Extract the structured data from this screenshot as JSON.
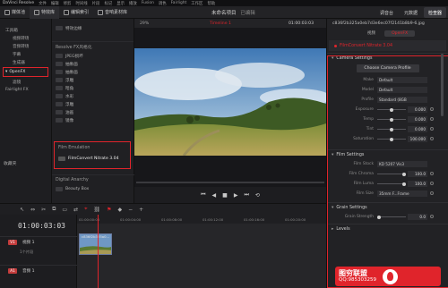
{
  "menu": {
    "app": "DaVinci Resolve",
    "items": [
      "文件",
      "编辑",
      "修剪",
      "时间线",
      "片段",
      "标记",
      "显示",
      "播放",
      "Fusion",
      "调色",
      "Fairlight",
      "工作区",
      "帮助"
    ]
  },
  "toolbar": {
    "media_pool": "媒体池",
    "effects_library": "特效库",
    "edit_index": "编辑索引",
    "sound_library": "音响素材库",
    "project_title": "未命名项目",
    "edited": "已编辑",
    "mixer": "调音台",
    "metadata": "元数据",
    "inspector": "检查器"
  },
  "bins": {
    "items": [
      {
        "label": "工具箱",
        "sub": false
      },
      {
        "label": "视频转场",
        "sub": true
      },
      {
        "label": "音频转场",
        "sub": true
      },
      {
        "label": "字幕",
        "sub": true
      },
      {
        "label": "生成器",
        "sub": true
      },
      {
        "label": "OpenFX",
        "sub": false,
        "highlight": true
      },
      {
        "label": "滤镜",
        "sub": true
      },
      {
        "label": "Fairlight FX",
        "sub": false
      }
    ],
    "favorites": "收藏夹"
  },
  "effects": {
    "top_item": "特效边缘",
    "section": "Resolve FX风格化",
    "items": [
      "JPEG损坏",
      "抽象画",
      "抽象画",
      "浮雕",
      "暗角",
      "水彩",
      "浮雕",
      "油画",
      "镜像"
    ],
    "film_section": "Film Emulation",
    "film_item": "FilmConvert Nitrate 3.04",
    "digital_section": "Digital Anarchy",
    "digital_item": "Beauty Box"
  },
  "viewer": {
    "zoom": "29%",
    "timeline_name": "Timeline 1",
    "timecode": "01:00:03:03",
    "transport": [
      "⏮",
      "◀",
      "■",
      "▶",
      "⏭",
      "⟲"
    ]
  },
  "inspector": {
    "file_name": "c836f2b325a0eb7d3e6ec07f2141b8b9-6.jpg",
    "tabs": [
      "视频",
      "OpenFX"
    ],
    "plugin": "FilmConvert Nitrate 3.04",
    "camera_section": "Camera Settings",
    "choose_profile": "Choose Camera Profile",
    "camera_rows": [
      {
        "label": "Make",
        "value": "Default"
      },
      {
        "label": "Model",
        "value": "Default"
      },
      {
        "label": "Profile",
        "value": "Standard (8GB"
      }
    ],
    "slider_rows": [
      {
        "label": "Exposure",
        "value": "0.000",
        "pos": 0.5
      },
      {
        "label": "Temp",
        "value": "0.000",
        "pos": 0.5
      },
      {
        "label": "Tint",
        "value": "0.000",
        "pos": 0.5
      },
      {
        "label": "Saturation",
        "value": "100.000",
        "pos": 0.5
      }
    ],
    "film_section": "Film Settings",
    "film_stock_label": "Film Stock",
    "film_stock_value": "KD 5207 Vis3",
    "film_rows": [
      {
        "label": "Film Chroma",
        "value": "100.0",
        "pos": 1.0
      },
      {
        "label": "Film Luma",
        "value": "100.0",
        "pos": 1.0
      },
      {
        "label": "Film Size",
        "value": "35mm F...Frame"
      }
    ],
    "grain_section": "Grain Settings",
    "grain_rows": [
      {
        "label": "Grain Strength",
        "value": "0.0",
        "pos": 0.0
      }
    ],
    "levels_section": "Levels"
  },
  "timeline": {
    "timecode": "01:00:03:03",
    "video_track": {
      "tag": "V1",
      "name": "视频 1",
      "clips": "1个片段"
    },
    "audio_track": {
      "tag": "A1",
      "name": "音频 1"
    },
    "ruler": [
      "01:00:00:00",
      "01:00:04:00",
      "01:00:08:00",
      "01:00:12:00",
      "01:00:16:00",
      "01:00:20:00"
    ],
    "clip_label": "c836f2b325a0..."
  },
  "watermark": {
    "title": "图穷联盟",
    "qq": "QQ:985303259"
  },
  "colors": {
    "accent": "#e0242b",
    "background": "#1c1c1e",
    "panel": "#222225"
  }
}
